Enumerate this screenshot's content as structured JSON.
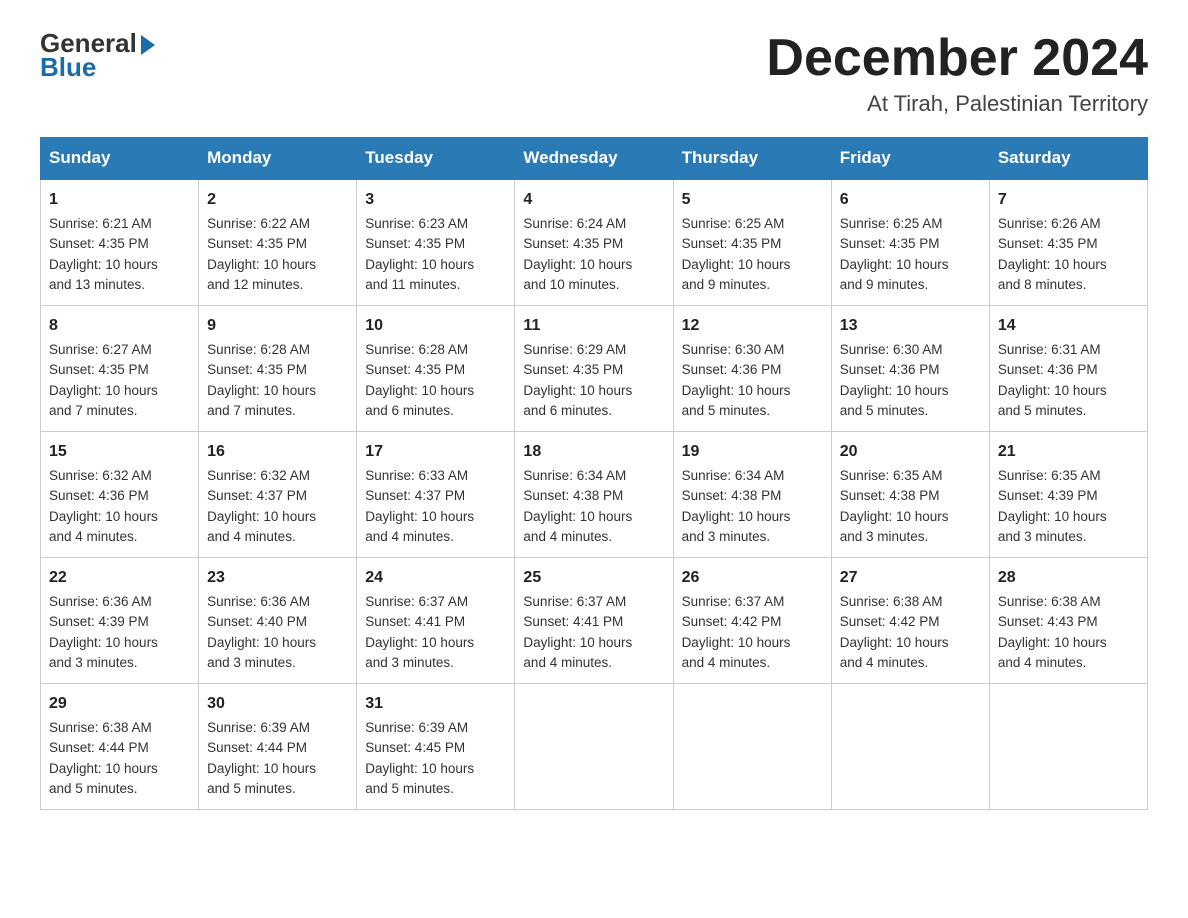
{
  "logo": {
    "line1": "General",
    "line2": "Blue"
  },
  "title": "December 2024",
  "subtitle": "At Tirah, Palestinian Territory",
  "days_header": [
    "Sunday",
    "Monday",
    "Tuesday",
    "Wednesday",
    "Thursday",
    "Friday",
    "Saturday"
  ],
  "weeks": [
    [
      {
        "day": "1",
        "sunrise": "6:21 AM",
        "sunset": "4:35 PM",
        "daylight": "10 hours and 13 minutes."
      },
      {
        "day": "2",
        "sunrise": "6:22 AM",
        "sunset": "4:35 PM",
        "daylight": "10 hours and 12 minutes."
      },
      {
        "day": "3",
        "sunrise": "6:23 AM",
        "sunset": "4:35 PM",
        "daylight": "10 hours and 11 minutes."
      },
      {
        "day": "4",
        "sunrise": "6:24 AM",
        "sunset": "4:35 PM",
        "daylight": "10 hours and 10 minutes."
      },
      {
        "day": "5",
        "sunrise": "6:25 AM",
        "sunset": "4:35 PM",
        "daylight": "10 hours and 9 minutes."
      },
      {
        "day": "6",
        "sunrise": "6:25 AM",
        "sunset": "4:35 PM",
        "daylight": "10 hours and 9 minutes."
      },
      {
        "day": "7",
        "sunrise": "6:26 AM",
        "sunset": "4:35 PM",
        "daylight": "10 hours and 8 minutes."
      }
    ],
    [
      {
        "day": "8",
        "sunrise": "6:27 AM",
        "sunset": "4:35 PM",
        "daylight": "10 hours and 7 minutes."
      },
      {
        "day": "9",
        "sunrise": "6:28 AM",
        "sunset": "4:35 PM",
        "daylight": "10 hours and 7 minutes."
      },
      {
        "day": "10",
        "sunrise": "6:28 AM",
        "sunset": "4:35 PM",
        "daylight": "10 hours and 6 minutes."
      },
      {
        "day": "11",
        "sunrise": "6:29 AM",
        "sunset": "4:35 PM",
        "daylight": "10 hours and 6 minutes."
      },
      {
        "day": "12",
        "sunrise": "6:30 AM",
        "sunset": "4:36 PM",
        "daylight": "10 hours and 5 minutes."
      },
      {
        "day": "13",
        "sunrise": "6:30 AM",
        "sunset": "4:36 PM",
        "daylight": "10 hours and 5 minutes."
      },
      {
        "day": "14",
        "sunrise": "6:31 AM",
        "sunset": "4:36 PM",
        "daylight": "10 hours and 5 minutes."
      }
    ],
    [
      {
        "day": "15",
        "sunrise": "6:32 AM",
        "sunset": "4:36 PM",
        "daylight": "10 hours and 4 minutes."
      },
      {
        "day": "16",
        "sunrise": "6:32 AM",
        "sunset": "4:37 PM",
        "daylight": "10 hours and 4 minutes."
      },
      {
        "day": "17",
        "sunrise": "6:33 AM",
        "sunset": "4:37 PM",
        "daylight": "10 hours and 4 minutes."
      },
      {
        "day": "18",
        "sunrise": "6:34 AM",
        "sunset": "4:38 PM",
        "daylight": "10 hours and 4 minutes."
      },
      {
        "day": "19",
        "sunrise": "6:34 AM",
        "sunset": "4:38 PM",
        "daylight": "10 hours and 3 minutes."
      },
      {
        "day": "20",
        "sunrise": "6:35 AM",
        "sunset": "4:38 PM",
        "daylight": "10 hours and 3 minutes."
      },
      {
        "day": "21",
        "sunrise": "6:35 AM",
        "sunset": "4:39 PM",
        "daylight": "10 hours and 3 minutes."
      }
    ],
    [
      {
        "day": "22",
        "sunrise": "6:36 AM",
        "sunset": "4:39 PM",
        "daylight": "10 hours and 3 minutes."
      },
      {
        "day": "23",
        "sunrise": "6:36 AM",
        "sunset": "4:40 PM",
        "daylight": "10 hours and 3 minutes."
      },
      {
        "day": "24",
        "sunrise": "6:37 AM",
        "sunset": "4:41 PM",
        "daylight": "10 hours and 3 minutes."
      },
      {
        "day": "25",
        "sunrise": "6:37 AM",
        "sunset": "4:41 PM",
        "daylight": "10 hours and 4 minutes."
      },
      {
        "day": "26",
        "sunrise": "6:37 AM",
        "sunset": "4:42 PM",
        "daylight": "10 hours and 4 minutes."
      },
      {
        "day": "27",
        "sunrise": "6:38 AM",
        "sunset": "4:42 PM",
        "daylight": "10 hours and 4 minutes."
      },
      {
        "day": "28",
        "sunrise": "6:38 AM",
        "sunset": "4:43 PM",
        "daylight": "10 hours and 4 minutes."
      }
    ],
    [
      {
        "day": "29",
        "sunrise": "6:38 AM",
        "sunset": "4:44 PM",
        "daylight": "10 hours and 5 minutes."
      },
      {
        "day": "30",
        "sunrise": "6:39 AM",
        "sunset": "4:44 PM",
        "daylight": "10 hours and 5 minutes."
      },
      {
        "day": "31",
        "sunrise": "6:39 AM",
        "sunset": "4:45 PM",
        "daylight": "10 hours and 5 minutes."
      },
      null,
      null,
      null,
      null
    ]
  ],
  "labels": {
    "sunrise": "Sunrise:",
    "sunset": "Sunset:",
    "daylight": "Daylight:"
  }
}
